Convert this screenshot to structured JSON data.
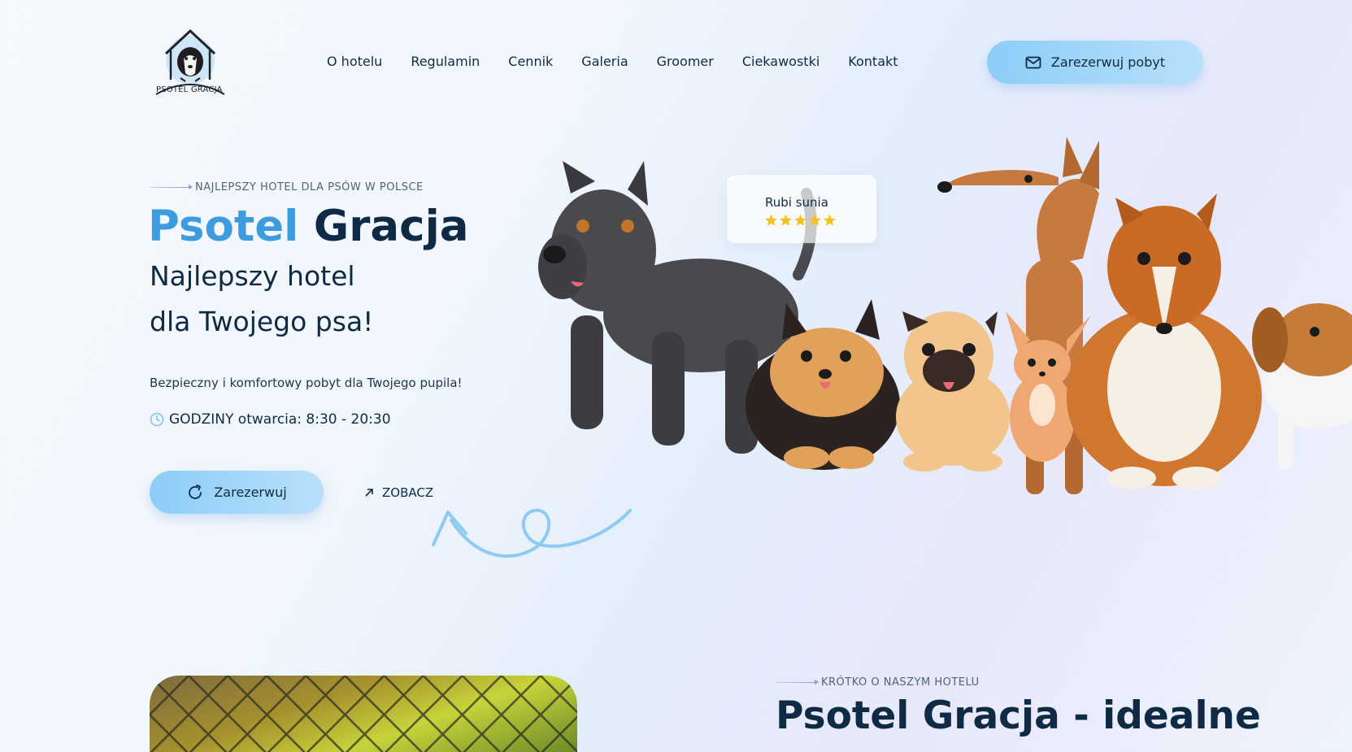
{
  "logo": {
    "name": "PSOTEL GRACJA"
  },
  "nav": {
    "items": [
      "O hotelu",
      "Regulamin",
      "Cennik",
      "Galeria",
      "Groomer",
      "Ciekawostki",
      "Kontakt"
    ]
  },
  "header_button": {
    "label": "Zarezerwuj pobyt",
    "icon": "mail-icon"
  },
  "hero": {
    "eyebrow": "NAJLEPSZY HOTEL DLA PSÓW W POLSCE",
    "title_accent": "Psotel",
    "title_rest": "Gracja",
    "subtitle_line1": "Najlepszy hotel",
    "subtitle_line2": "dla Twojego psa!",
    "description": "Bezpieczny i komfortowy pobyt dla Twojego pupila!",
    "hours_label": "GODZINY otwarcia: 8:30 - 20:30",
    "reserve_button": "Zarezerwuj",
    "see_link": "ZOBACZ"
  },
  "rating": {
    "name": "Rubi sunia",
    "stars": 5
  },
  "about": {
    "eyebrow": "KRÓTKO O NASZYM HOTELU",
    "title": "Psotel Gracja - idealne"
  },
  "colors": {
    "accent": "#3d9be0",
    "dark": "#0f2a44",
    "button_from": "#8ccdf7",
    "button_to": "#b9e0fb",
    "star": "#f6c21a"
  }
}
